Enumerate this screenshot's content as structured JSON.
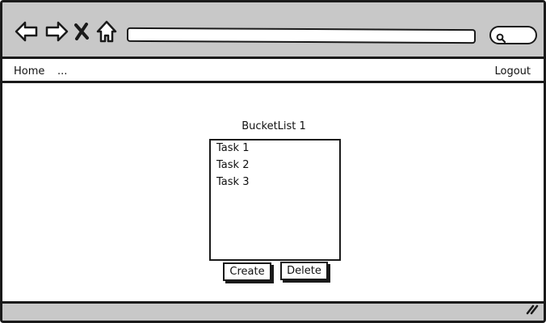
{
  "browser": {
    "icons": [
      "back-arrow-icon",
      "forward-arrow-icon",
      "close-icon",
      "home-icon",
      "search-icon",
      "resize-grip-icon"
    ]
  },
  "menu": {
    "home": "Home",
    "more": "...",
    "logout": "Logout"
  },
  "bucket_list": {
    "title": "BucketList 1",
    "items": [
      "Task 1",
      "Task 2",
      "Task 3"
    ]
  },
  "actions": {
    "create": "Create",
    "delete": "Delete"
  },
  "colors": {
    "chrome_gray": "#c8c8c8",
    "stroke": "#1a1a1a"
  }
}
